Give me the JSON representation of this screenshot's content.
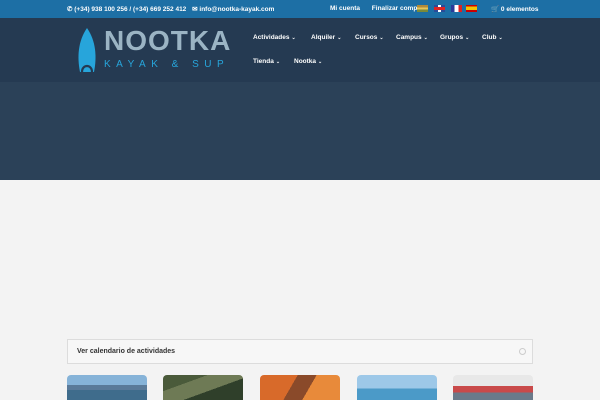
{
  "topbar": {
    "phone": "(+34) 938 100 256 / (+34) 669 252 412",
    "email": "info@nootka-kayak.com",
    "links": [
      "Mi cuenta",
      "Finalizar compra"
    ],
    "cart": "0 elementos",
    "languages": [
      "lang-1",
      "english",
      "français",
      "español"
    ]
  },
  "logo": {
    "wordmark": "NOOTKA",
    "tagline": "KAYAK & SUP"
  },
  "nav": {
    "row1": [
      {
        "label": "Actividades",
        "chev": "⌄"
      },
      {
        "label": "Alquiler",
        "chev": "⌄"
      },
      {
        "label": "Cursos",
        "chev": "⌄"
      },
      {
        "label": "Campus",
        "chev": "⌄"
      },
      {
        "label": "Grupos",
        "chev": "⌄"
      },
      {
        "label": "Club",
        "chev": "⌄"
      }
    ],
    "row2": [
      {
        "label": "Tienda",
        "chev": "⌄"
      },
      {
        "label": "Nootka",
        "chev": "⌄"
      }
    ]
  },
  "accordion": {
    "title": "Ver calendario de actividades"
  },
  "colors": {
    "topbar": "#1d6fa5",
    "header": "#253a52",
    "hero": "#2b4158",
    "accent": "#27a5db"
  },
  "icons": {
    "phone": "phone-icon",
    "email": "email-icon",
    "cart": "cart-icon"
  }
}
